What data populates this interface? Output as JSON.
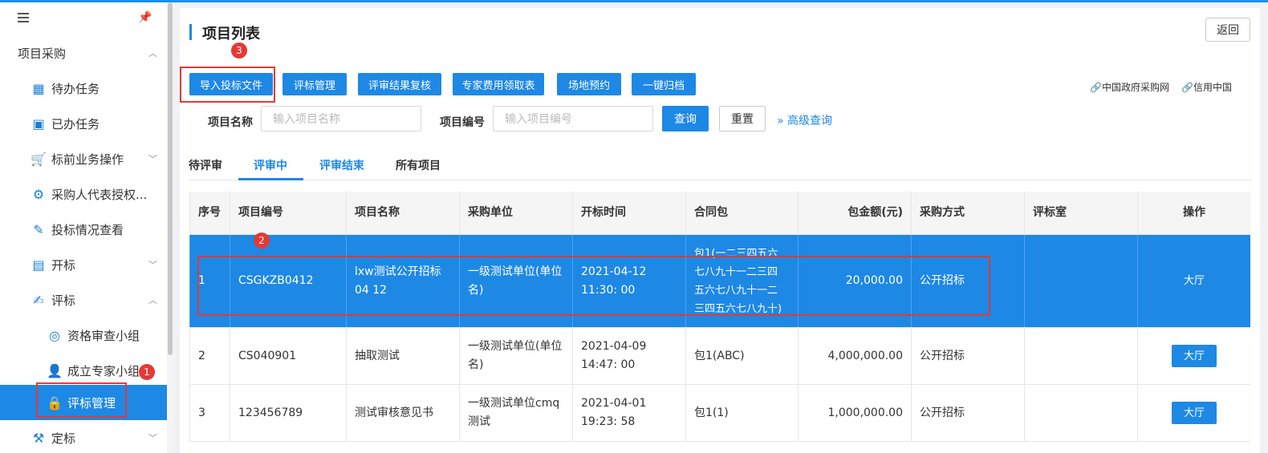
{
  "sidebar": {
    "section_label": "项目采购",
    "items": [
      {
        "label": "待办任务"
      },
      {
        "label": "已办任务"
      },
      {
        "label": "标前业务操作"
      },
      {
        "label": "采购人代表授权..."
      },
      {
        "label": "投标情况查看"
      },
      {
        "label": "开标"
      },
      {
        "label": "评标"
      },
      {
        "label": "资格审查小组"
      },
      {
        "label": "成立专家小组"
      },
      {
        "label": "评标管理"
      },
      {
        "label": "定标"
      }
    ]
  },
  "main": {
    "title": "项目列表",
    "back_label": "返回",
    "toolbar": [
      "导入投标文件",
      "评标管理",
      "评审结果复核",
      "专家费用领取表",
      "场地预约",
      "一键归档"
    ],
    "links": [
      "中国政府采购网",
      "信用中国"
    ],
    "filters": {
      "name_label": "项目名称",
      "name_placeholder": "输入项目名称",
      "code_label": "项目编号",
      "code_placeholder": "输入项目编号",
      "query_label": "查询",
      "reset_label": "重置",
      "advanced_label": "高级查询"
    },
    "tabs": [
      "待评审",
      "评审中",
      "评审结束",
      "所有项目"
    ],
    "active_tab": "评审中"
  },
  "table": {
    "headers": [
      "序号",
      "项目编号",
      "项目名称",
      "采购单位",
      "开标时间",
      "合同包",
      "包金额(元)",
      "采购方式",
      "评标室",
      "操作"
    ],
    "rows": [
      {
        "no": "1",
        "code": "CSGKZB0412",
        "name": "lxw测试公开招标04 12",
        "unit": "一级测试单位(单位 名)",
        "time": "2021-04-12 11:30: 00",
        "package": "包1(一二三四五六 七八九十一二三四 五六七八九十一二 三四五六七八九十)",
        "amount": "20,000.00",
        "method": "公开招标",
        "room": "",
        "action": "大厅"
      },
      {
        "no": "2",
        "code": "CS040901",
        "name": "抽取测试",
        "unit": "一级测试单位(单位 名)",
        "time": "2021-04-09 14:47: 00",
        "package": "包1(ABC)",
        "amount": "4,000,000.00",
        "method": "公开招标",
        "room": "",
        "action": "大厅"
      },
      {
        "no": "3",
        "code": "123456789",
        "name": "测试审核意见书",
        "unit": "一级测试单位cmq 测试",
        "time": "2021-04-01 19:23: 58",
        "package": "包1(1)",
        "amount": "1,000,000.00",
        "method": "公开招标",
        "room": "",
        "action": "大厅"
      }
    ]
  },
  "annotations": [
    "1",
    "2",
    "3"
  ],
  "colors": {
    "accent": "#1e88e5",
    "annotation": "#e53935"
  }
}
